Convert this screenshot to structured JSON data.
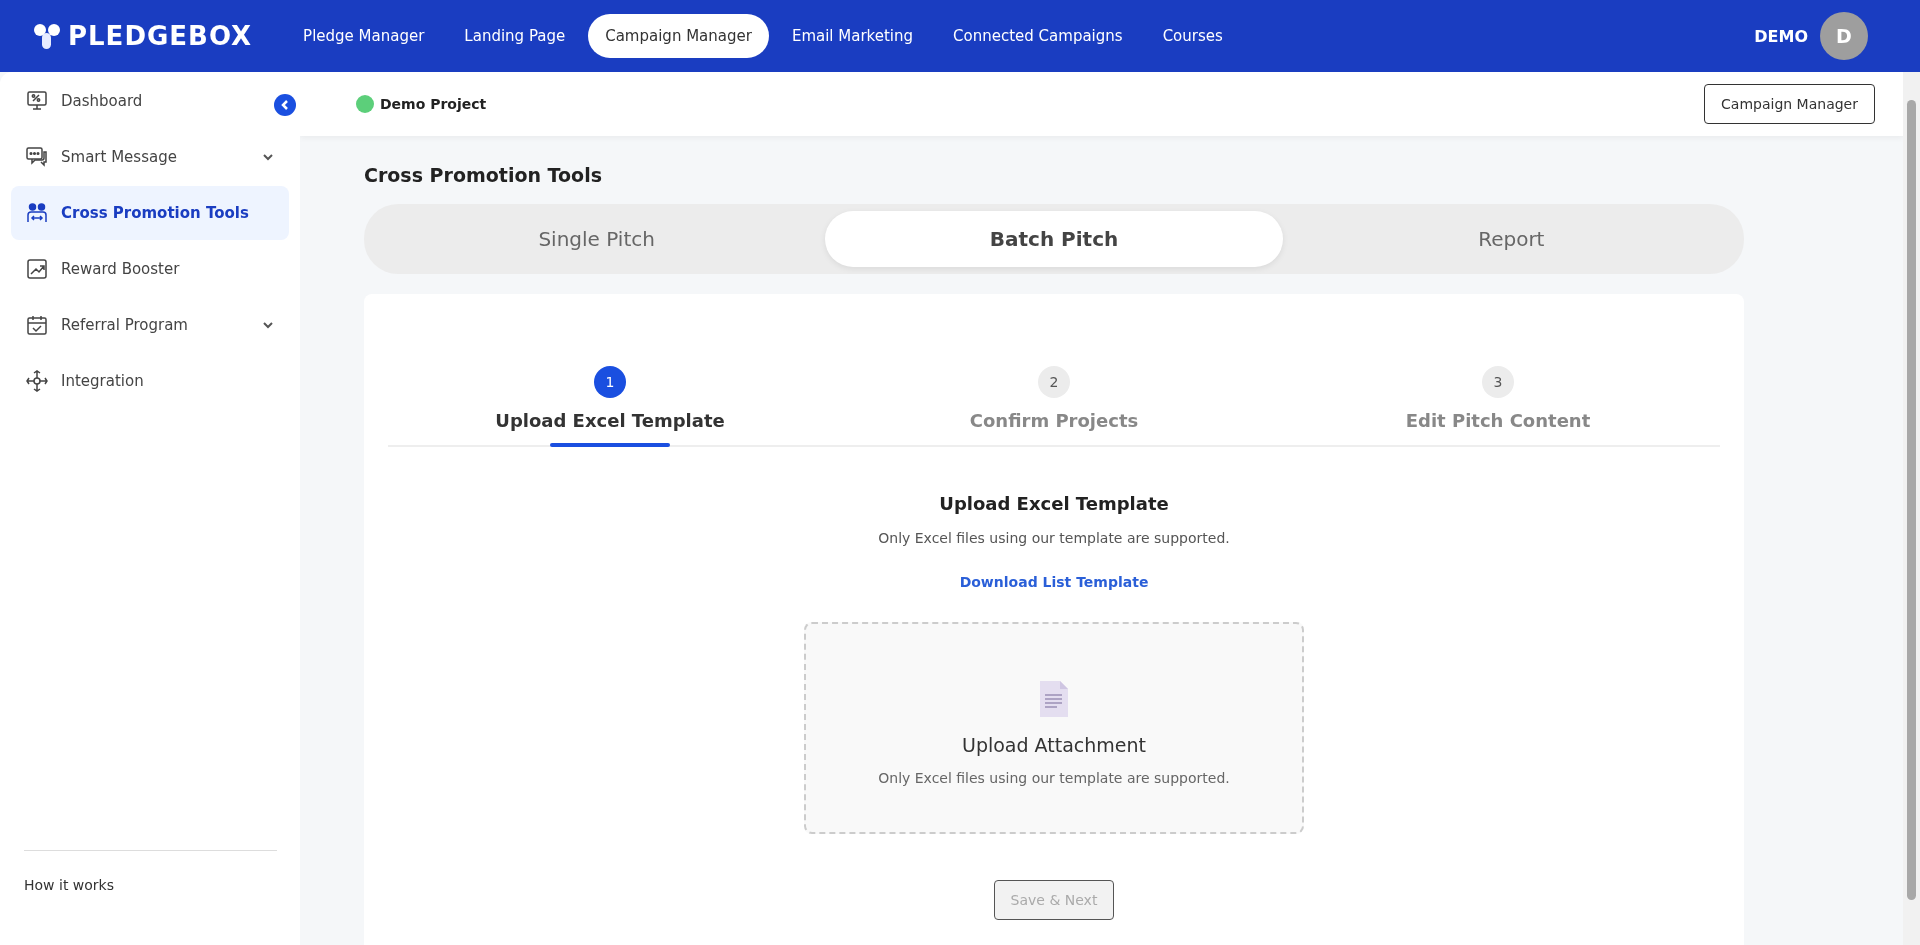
{
  "top_nav": {
    "logo": "PLEDGEBOX",
    "items": [
      {
        "label": "Pledge Manager",
        "selected": false
      },
      {
        "label": "Landing Page",
        "selected": false
      },
      {
        "label": "Campaign Manager",
        "selected": true
      },
      {
        "label": "Email Marketing",
        "selected": false
      },
      {
        "label": "Connected Campaigns",
        "selected": false
      },
      {
        "label": "Courses",
        "selected": false
      }
    ],
    "user": "DEMO",
    "avatar": "D"
  },
  "sidebar": {
    "items": [
      {
        "label": "Dashboard",
        "selected": false,
        "expandable": false
      },
      {
        "label": "Smart Message",
        "selected": false,
        "expandable": true
      },
      {
        "label": "Cross Promotion Tools",
        "selected": true,
        "expandable": false
      },
      {
        "label": "Reward Booster",
        "selected": false,
        "expandable": false
      },
      {
        "label": "Referral Program",
        "selected": false,
        "expandable": true
      },
      {
        "label": "Integration",
        "selected": false,
        "expandable": false
      }
    ],
    "footer_link": "How it works"
  },
  "header": {
    "project": "Demo Project",
    "button": "Campaign Manager"
  },
  "page_title": "Cross Promotion Tools",
  "tabs": [
    {
      "label": "Single Pitch",
      "selected": false
    },
    {
      "label": "Batch Pitch",
      "selected": true
    },
    {
      "label": "Report",
      "selected": false
    }
  ],
  "steps": [
    {
      "number": "1",
      "label": "Upload Excel Template",
      "selected": true
    },
    {
      "number": "2",
      "label": "Confirm Projects",
      "selected": false
    },
    {
      "number": "3",
      "label": "Edit Pitch Content",
      "selected": false
    }
  ],
  "upload": {
    "title": "Upload Excel Template",
    "subtitle": "Only Excel files using our template are supported.",
    "link": "Download List Template",
    "dropzone_title": "Upload Attachment",
    "dropzone_hint": "Only Excel files using our template are supported."
  },
  "save_button": {
    "label": "Save & Next",
    "disabled": true
  }
}
